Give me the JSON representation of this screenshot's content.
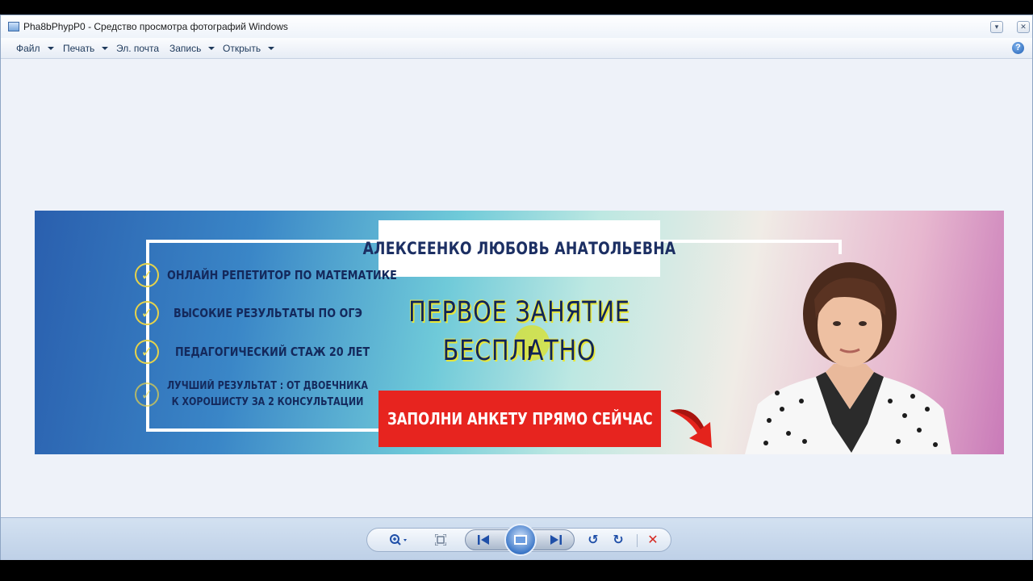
{
  "window": {
    "title": "Pha8bPhypP0 - Средство просмотра фотографий Windows",
    "minimize": "▾",
    "close": "✕"
  },
  "menu": {
    "file": "Файл",
    "print": "Печать",
    "email": "Эл. почта",
    "burn": "Запись",
    "open": "Открыть",
    "help": "?"
  },
  "banner": {
    "name": "АЛЕКСЕЕНКО ЛЮБОВЬ АНАТОЛЬЕВНА",
    "bullets": [
      "ОНЛАЙН РЕПЕТИТОР ПО МАТЕМАТИКЕ",
      "ВЫСОКИЕ РЕЗУЛЬТАТЫ ПО ОГЭ",
      "ПЕДАГОГИЧЕСКИЙ СТАЖ 20 ЛЕТ"
    ],
    "bullet4_line1": "ЛУЧШИЙ РЕЗУЛЬТАТ : ОТ ДВОЕЧНИКА",
    "bullet4_line2": "К ХОРОШИСТУ ЗА 2 КОНСУЛЬТАЦИИ",
    "promo_line1": "ПЕРВОЕ ЗАНЯТИЕ",
    "promo_line2": "БЕСПЛАТНО",
    "cta": "ЗАПОЛНИ АНКЕТУ ПРЯМО СЕЙЧАС"
  },
  "icons": {
    "check": "✓",
    "zoom": "search-zoom-icon",
    "fit": "actual-size-icon",
    "prev": "previous-icon",
    "slideshow": "slideshow-icon",
    "next": "next-icon",
    "rotate_ccw": "↺",
    "rotate_cw": "↻",
    "delete": "✕"
  }
}
